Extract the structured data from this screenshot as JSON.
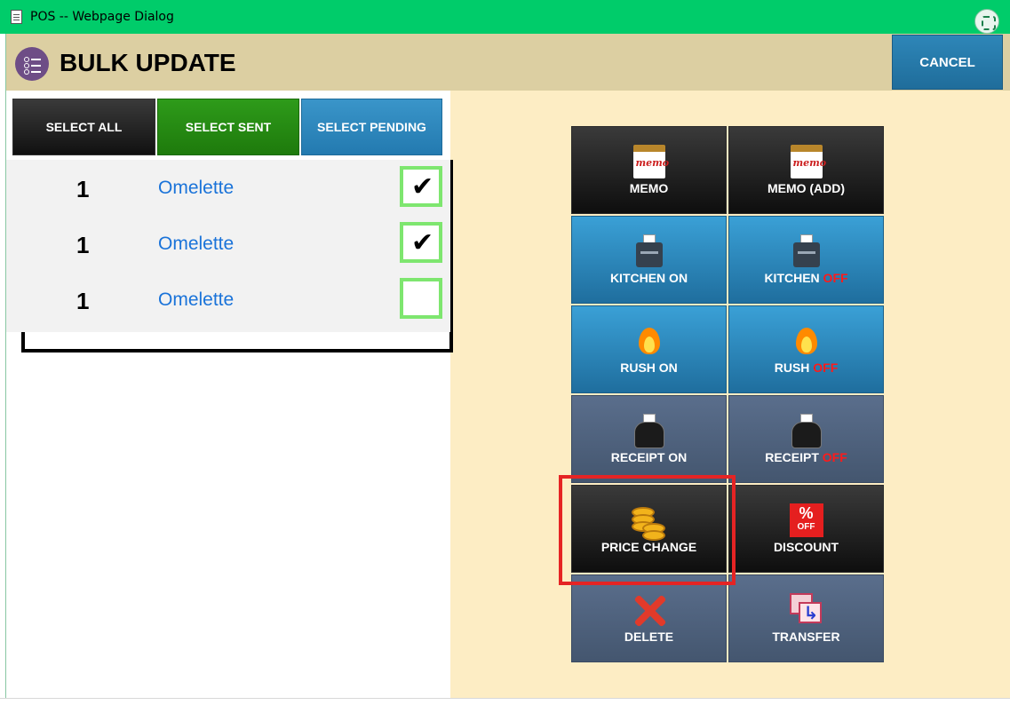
{
  "window": {
    "title": "POS -- Webpage Dialog"
  },
  "header": {
    "title": "BULK UPDATE",
    "cancel_label": "CANCEL"
  },
  "selection": {
    "select_all": "SELECT ALL",
    "select_sent": "SELECT SENT",
    "select_pending": "SELECT PENDING"
  },
  "items": [
    {
      "qty": "1",
      "name": "Omelette",
      "checked": true,
      "tick": "✔"
    },
    {
      "qty": "1",
      "name": "Omelette",
      "checked": true,
      "tick": "✔"
    },
    {
      "qty": "1",
      "name": "Omelette",
      "checked": false,
      "tick": ""
    }
  ],
  "actions": {
    "memo": "MEMO",
    "memo_add": "MEMO (ADD)",
    "kitchen_on": "KITCHEN ON",
    "kitchen_off_prefix": "KITCHEN",
    "kitchen_off_suffix": " OFF",
    "rush_on": "RUSH ON",
    "rush_off_prefix": "RUSH",
    "rush_off_suffix": " OFF",
    "receipt_on": "RECEIPT ON",
    "receipt_off_prefix": "RECEIPT",
    "receipt_off_suffix": " OFF",
    "price_change": "PRICE CHANGE",
    "discount": "DISCOUNT",
    "discount_icon_pct": "%",
    "discount_icon_off": "OFF",
    "delete": "DELETE",
    "transfer": "TRANSFER"
  },
  "colors": {
    "titlebar": "#00cc6a",
    "header": "#dccfa2",
    "right_pane": "#fdedc4",
    "highlight": "#e52424",
    "off_text": "#ff1a1a"
  }
}
